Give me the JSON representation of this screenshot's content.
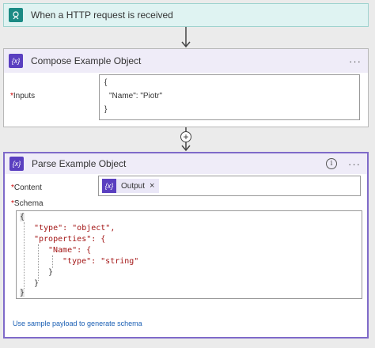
{
  "trigger": {
    "title": "When a HTTP request is received",
    "icon": "http-request-icon"
  },
  "compose": {
    "title": "Compose Example Object",
    "icon": "compose-icon",
    "more": "···",
    "inputs_label": "Inputs",
    "required_mark": "*",
    "inputs_lines": [
      "{",
      "\"Name\": \"Piotr\"",
      "}"
    ]
  },
  "insert_step": {
    "icon": "plus-icon",
    "symbol": "+"
  },
  "parse": {
    "title": "Parse Example Object",
    "icon": "parse-json-icon",
    "info_symbol": "i",
    "more": "···",
    "content_label": "Content",
    "token_label": "Output",
    "token_remove": "×",
    "schema_label": "Schema",
    "schema_lines": [
      "{",
      "\"type\": \"object\",",
      "\"properties\": {",
      "\"Name\": {",
      "\"type\": \"string\"",
      "}",
      "}",
      "}"
    ],
    "sample_link": "Use sample payload to generate schema"
  },
  "colors": {
    "trigger_accent": "#1b8a84",
    "trigger_header_bg": "#dff3f2",
    "action_accent": "#5a3fc0",
    "action_header_bg": "#efecf8",
    "selected_border": "#7f6ac9",
    "string_color": "#a31515",
    "link_color": "#1a5fb4"
  }
}
